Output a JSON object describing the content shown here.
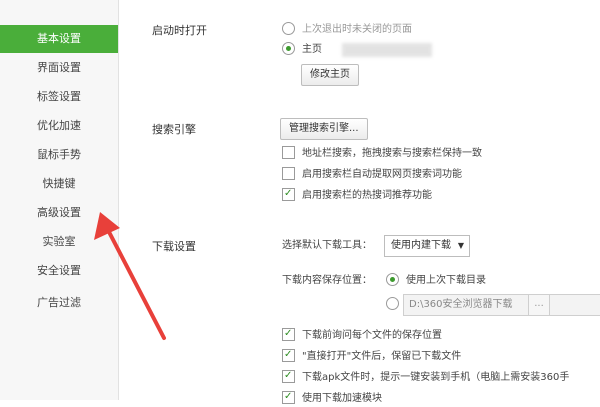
{
  "sidebar": {
    "items": [
      {
        "label": "基本设置"
      },
      {
        "label": "界面设置"
      },
      {
        "label": "标签设置"
      },
      {
        "label": "优化加速"
      },
      {
        "label": "鼠标手势"
      },
      {
        "label": "快捷键"
      },
      {
        "label": "高级设置"
      },
      {
        "label": "实验室"
      },
      {
        "label": "安全设置"
      },
      {
        "label": "广告过滤"
      }
    ]
  },
  "startup": {
    "title": "启动时打开",
    "option_last": "上次退出时未关闭的页面",
    "option_home": "主页",
    "edit_home_btn": "修改主页"
  },
  "search": {
    "title": "搜索引擎",
    "manage_btn": "管理搜索引擎...",
    "opt1": "地址栏搜索，拖拽搜索与搜索栏保持一致",
    "opt2": "启用搜索栏自动提取网页搜索词功能",
    "opt3": "启用搜索栏的热搜词推荐功能"
  },
  "download": {
    "title": "下载设置",
    "tool_label": "选择默认下载工具：",
    "tool_value": "使用内建下载",
    "save_label": "下载内容保存位置：",
    "save_last": "使用上次下载目录",
    "save_path": "D:\\360安全浏览器下载",
    "path_btn": "...",
    "opt1": "下载前询问每个文件的保存位置",
    "opt2": "\"直接打开\"文件后，保留已下载文件",
    "opt3": "下载apk文件时，提示一键安装到手机（电脑上需安装360手",
    "opt4": "使用下载加速模块"
  },
  "colors": {
    "accent": "#4aae3a",
    "arrow": "#e8403a"
  }
}
